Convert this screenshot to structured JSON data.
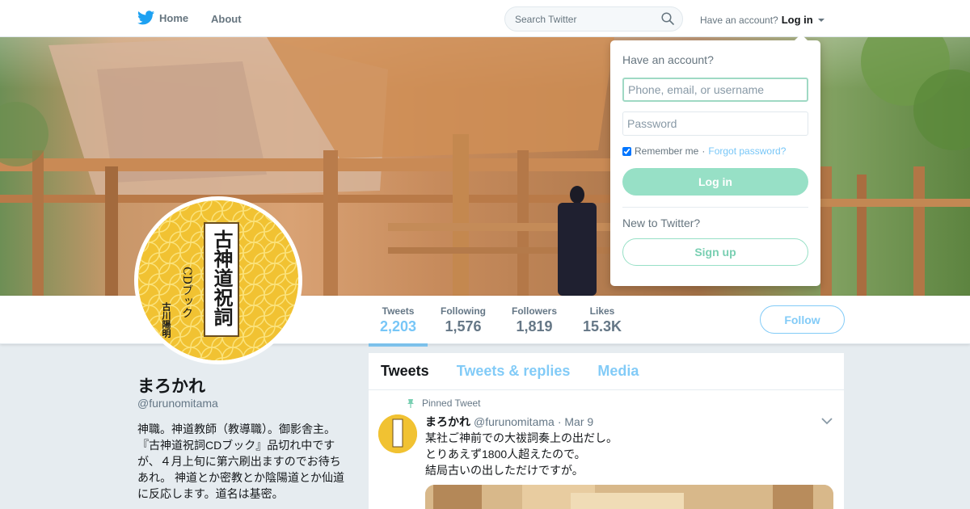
{
  "nav": {
    "home": "Home",
    "about": "About",
    "search_placeholder": "Search Twitter",
    "have_account": "Have an account?",
    "login": "Log in"
  },
  "profile": {
    "name": "まろかれ",
    "handle": "@furunomitama",
    "bio": "神職。神道教師（教導職）。御影舎主。『古神道祝詞CDブック』品切れ中ですが、４月上旬に第六刷出ますのでお待ちあれ。 神道とか密教とか陰陽道とか仙道に反応します。道名は基密。",
    "avatar_text": "古神道祝詞",
    "avatar_subtext": "CDブック",
    "avatar_author": "古川陽明"
  },
  "stats": [
    {
      "label": "Tweets",
      "value": "2,203"
    },
    {
      "label": "Following",
      "value": "1,576"
    },
    {
      "label": "Followers",
      "value": "1,819"
    },
    {
      "label": "Likes",
      "value": "15.3K"
    }
  ],
  "follow_label": "Follow",
  "tabs": [
    "Tweets",
    "Tweets & replies",
    "Media"
  ],
  "tweet": {
    "pinned_label": "Pinned Tweet",
    "name": "まろかれ",
    "handle": "@furunomitama",
    "date": "· Mar 9",
    "lines": [
      "某社ご神前での大祓詞奏上の出だし。",
      "とりあえず1800人超えたので。",
      "結局古いの出しただけですが。"
    ]
  },
  "login_dropdown": {
    "title": "Have an account?",
    "username_placeholder": "Phone, email, or username",
    "password_placeholder": "Password",
    "remember": "Remember me",
    "separator": "·",
    "forgot": "Forgot password?",
    "login_button": "Log in",
    "new_to": "New to Twitter?",
    "signup_button": "Sign up"
  },
  "colors": {
    "accent": "#1da1f2",
    "login_button": "#97e0c6",
    "avatar_gold": "#f1c232"
  }
}
